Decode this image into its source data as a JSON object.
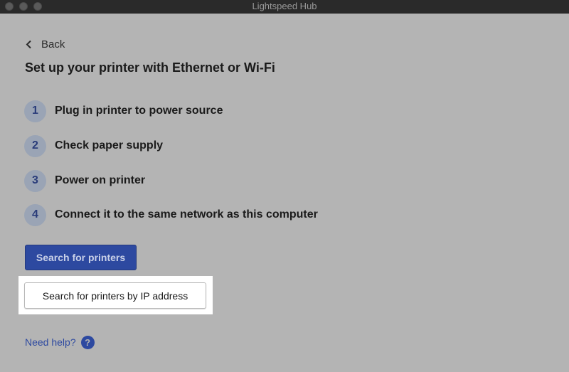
{
  "window": {
    "title": "Lightspeed Hub"
  },
  "nav": {
    "back_label": "Back"
  },
  "page": {
    "title": "Set up your printer with Ethernet or Wi-Fi"
  },
  "steps": [
    {
      "number": "1",
      "label": "Plug in printer to power source"
    },
    {
      "number": "2",
      "label": "Check paper supply"
    },
    {
      "number": "3",
      "label": "Power on printer"
    },
    {
      "number": "4",
      "label": "Connect it to the same network as this computer"
    }
  ],
  "actions": {
    "search_label": "Search for printers",
    "search_ip_label": "Search for printers by IP address"
  },
  "help": {
    "label": "Need help?",
    "icon_glyph": "?"
  },
  "colors": {
    "accent": "#2d49a0",
    "background": "#b4b4b4",
    "step_circle": "#9aa4b5"
  }
}
